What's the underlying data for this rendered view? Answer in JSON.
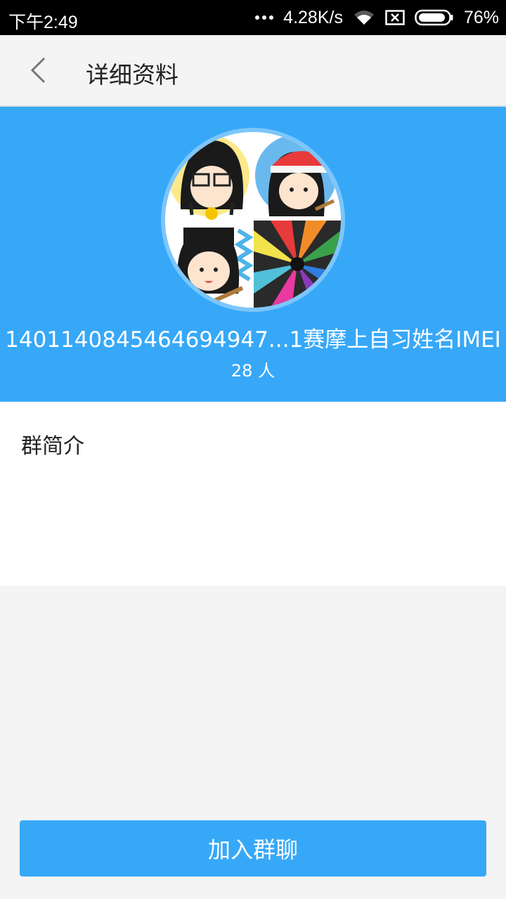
{
  "status_bar": {
    "time": "下午2:49",
    "network_speed": "4.28K/s",
    "battery": "76%",
    "icons": [
      "more-dots-icon",
      "wifi-icon",
      "sim-blocked-icon",
      "battery-icon"
    ]
  },
  "header": {
    "back_icon": "chevron-left-icon",
    "title": "详细资料"
  },
  "group": {
    "name": "14011408454646949​47...1赛摩上自习姓名IMEI",
    "members": "28 人",
    "avatar_tiles": [
      "cartoon-girl-glasses",
      "cartoon-girl-red-cap",
      "cartoon-girl-guitar",
      "colored-pencils"
    ]
  },
  "intro": {
    "title": "群简介",
    "body": ""
  },
  "actions": {
    "join_label": "加入群聊"
  },
  "colors": {
    "accent": "#37a8f8",
    "background": "#f4f4f4"
  }
}
